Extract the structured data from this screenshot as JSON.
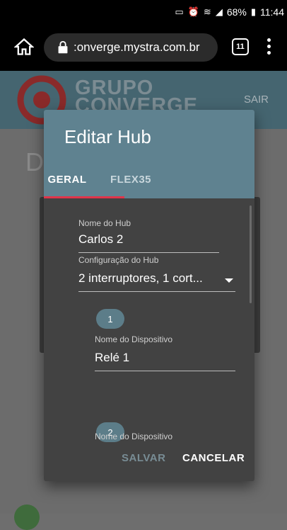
{
  "status_bar": {
    "battery": "68%",
    "time": "11:44"
  },
  "browser": {
    "url": ":onverge.mystra.com.br",
    "tab_count": "11"
  },
  "app": {
    "logo_line1": "GRUPO",
    "logo_line2": "CONVERGE",
    "logout_label": "SAIR",
    "bg_letter": "D"
  },
  "dialog": {
    "title": "Editar Hub",
    "tabs": [
      {
        "label": "GERAL"
      },
      {
        "label": "FLEX35"
      }
    ],
    "fields": {
      "hub_name_label": "Nome do Hub",
      "hub_name_value": "Carlos 2",
      "hub_config_label": "Configuração do Hub",
      "hub_config_value": "2 interruptores, 1 cort..."
    },
    "devices": [
      {
        "number": "1",
        "name_label": "Nome do Dispositivo",
        "name_value": "Relé 1"
      },
      {
        "number": "2",
        "name_label": "Nome do Dispositivo",
        "name_value": ""
      }
    ],
    "save_label": "SALVAR",
    "cancel_label": "CANCELAR"
  }
}
